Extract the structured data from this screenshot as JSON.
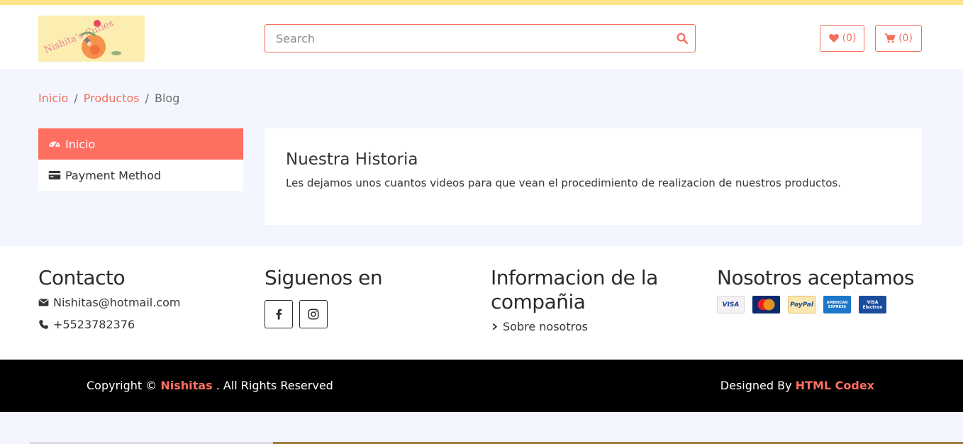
{
  "header": {
    "logo_text": "Nishita's Cuties",
    "search_placeholder": "Search",
    "wishlist_count": "(0)",
    "cart_count": "(0)"
  },
  "breadcrumb": {
    "items": [
      "Inicio",
      "Productos",
      "Blog"
    ],
    "separator": "/"
  },
  "sidebar": {
    "items": [
      {
        "label": "Inicio",
        "icon": "dashboard-icon",
        "active": true
      },
      {
        "label": "Payment Method",
        "icon": "credit-card-icon",
        "active": false
      }
    ]
  },
  "content": {
    "title": "Nuestra Historia",
    "text": "Les dejamos unos cuantos videos para que vean el procedimiento de realizacion de nuestros productos."
  },
  "footer": {
    "contact": {
      "title": "Contacto",
      "email": "Nishitas@hotmail.com",
      "phone": "+5523782376"
    },
    "follow": {
      "title": "Siguenos en",
      "networks": [
        "facebook-icon",
        "instagram-icon"
      ]
    },
    "company": {
      "title": "Informacion de la compañia",
      "link": "Sobre nosotros"
    },
    "payments": {
      "title": "Nosotros aceptamos",
      "cards": [
        "VISA",
        "MasterCard",
        "PayPal",
        "AMERICAN EXPRESS",
        "VISA Electron"
      ]
    }
  },
  "copyright": {
    "prefix": "Copyright ©",
    "brand": "Nishitas",
    "suffix": ". All Rights Reserved",
    "designed_prefix": "Designed By",
    "designer": "HTML Codex"
  },
  "colors": {
    "accent": "#ff6f61",
    "topbar": "#fde48b",
    "page_bg": "#f3f6ff"
  }
}
